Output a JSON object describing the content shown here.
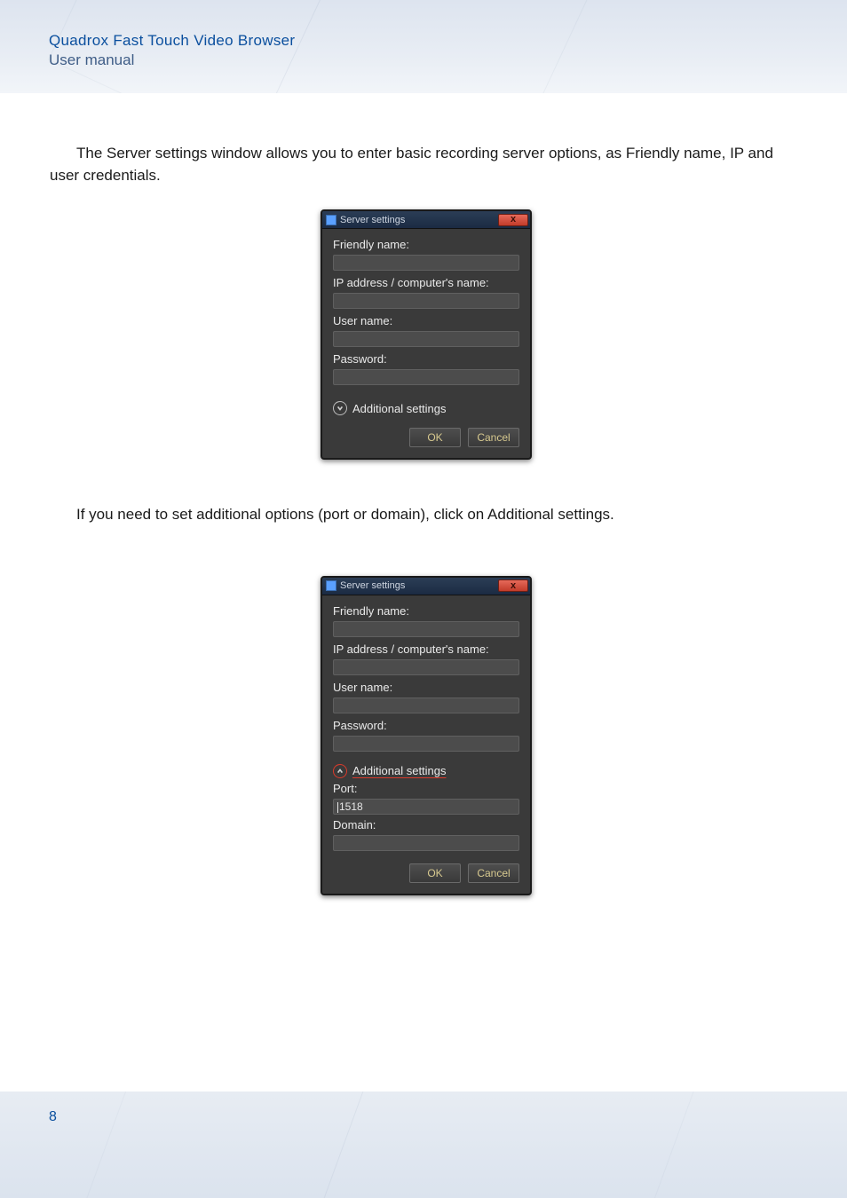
{
  "header": {
    "title": "Quadrox Fast Touch Video Browser",
    "subtitle": "User manual"
  },
  "paragraph1": "The Server settings window allows you to enter basic recording server options, as Friendly name, IP and user credentials.",
  "paragraph2": "If you need to set additional options (port or domain), click on Additional settings.",
  "dialog1": {
    "title": "Server settings",
    "close_glyph": "x",
    "labels": {
      "friendly": "Friendly name:",
      "ip": "IP address / computer's name:",
      "user": "User name:",
      "password": "Password:",
      "additional": "Additional settings"
    },
    "buttons": {
      "ok": "OK",
      "cancel": "Cancel"
    }
  },
  "dialog2": {
    "title": "Server settings",
    "close_glyph": "x",
    "labels": {
      "friendly": "Friendly name:",
      "ip": "IP address / computer's name:",
      "user": "User name:",
      "password": "Password:",
      "additional": "Additional settings",
      "port": "Port:",
      "domain": "Domain:"
    },
    "values": {
      "port": "1518"
    },
    "buttons": {
      "ok": "OK",
      "cancel": "Cancel"
    }
  },
  "page_number": "8"
}
